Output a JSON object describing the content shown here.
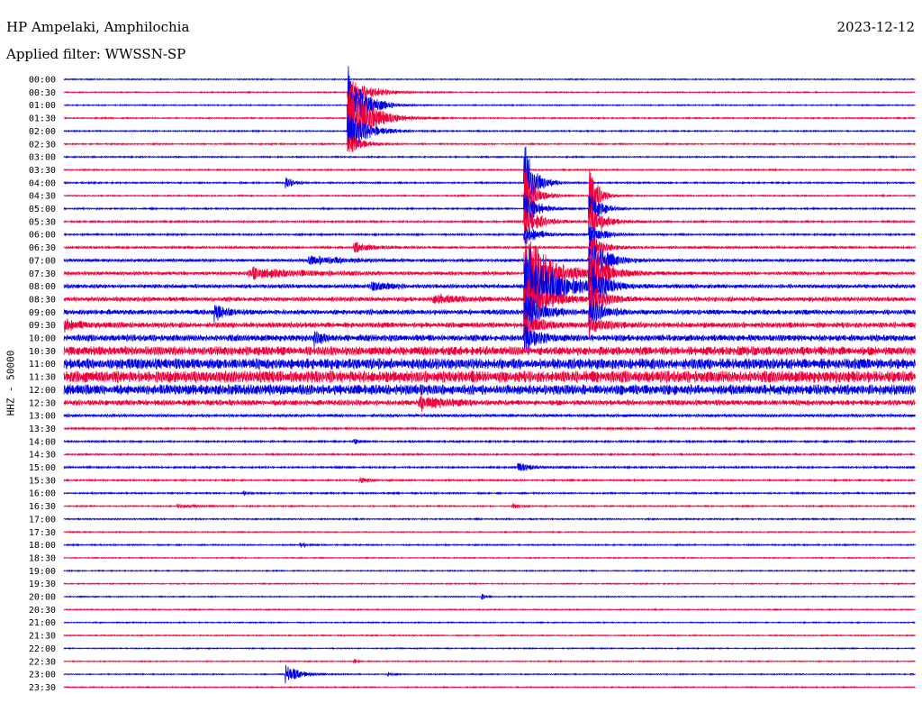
{
  "header": {
    "station": "HP Ampelaki, Amphilochia",
    "date": "2023-12-12",
    "filter": "Applied filter: WWSSN-SP"
  },
  "colors": {
    "trace_a": "#0000e6",
    "trace_b": "#f0003c"
  },
  "chart_data": {
    "type": "line",
    "title": "HP Ampelaki, Amphilochia",
    "ylabel": "HHZ - 50000",
    "x_range_min": [
      0,
      30
    ],
    "rows": [
      "00:00",
      "00:30",
      "01:00",
      "01:30",
      "02:00",
      "02:30",
      "03:00",
      "03:30",
      "04:00",
      "04:30",
      "05:00",
      "05:30",
      "06:00",
      "06:30",
      "07:00",
      "07:30",
      "08:00",
      "08:30",
      "09:00",
      "09:30",
      "10:00",
      "10:30",
      "11:00",
      "11:30",
      "12:00",
      "12:30",
      "13:00",
      "13:30",
      "14:00",
      "14:30",
      "15:00",
      "15:30",
      "16:00",
      "16:30",
      "17:00",
      "17:30",
      "18:00",
      "18:30",
      "19:00",
      "19:30",
      "20:00",
      "20:30",
      "21:00",
      "21:30",
      "22:00",
      "22:30",
      "23:00",
      "23:30"
    ],
    "noise_level": [
      0.5,
      0.5,
      0.5,
      0.6,
      0.6,
      0.6,
      0.6,
      0.6,
      0.7,
      0.6,
      0.7,
      0.8,
      0.8,
      1.0,
      1.2,
      1.4,
      1.6,
      1.8,
      2.0,
      2.2,
      2.6,
      3.6,
      4.4,
      4.8,
      4.2,
      2.2,
      1.2,
      0.9,
      0.8,
      0.7,
      0.8,
      0.7,
      0.7,
      0.6,
      0.6,
      0.5,
      0.6,
      0.5,
      0.5,
      0.5,
      0.5,
      0.5,
      0.5,
      0.5,
      0.5,
      0.5,
      0.5,
      0.5
    ],
    "events": [
      {
        "row": 1,
        "t": 10.0,
        "amp": 14,
        "dur": 1.6
      },
      {
        "row": 2,
        "t": 10.0,
        "amp": 36,
        "dur": 1.2
      },
      {
        "row": 3,
        "t": 10.0,
        "amp": 36,
        "dur": 1.6
      },
      {
        "row": 4,
        "t": 10.0,
        "amp": 20,
        "dur": 1.4
      },
      {
        "row": 5,
        "t": 10.0,
        "amp": 10,
        "dur": 1.0
      },
      {
        "row": 8,
        "t": 7.8,
        "amp": 6,
        "dur": 0.6
      },
      {
        "row": 13,
        "t": 10.2,
        "amp": 5,
        "dur": 1.2
      },
      {
        "row": 14,
        "t": 8.6,
        "amp": 4,
        "dur": 3.0
      },
      {
        "row": 15,
        "t": 6.5,
        "amp": 5,
        "dur": 4.0
      },
      {
        "row": 16,
        "t": 10.8,
        "amp": 5,
        "dur": 1.2
      },
      {
        "row": 17,
        "t": 13.0,
        "amp": 4,
        "dur": 2.0
      },
      {
        "row": 18,
        "t": 5.3,
        "amp": 8,
        "dur": 0.8
      },
      {
        "row": 19,
        "t": 0.0,
        "amp": 5,
        "dur": 1.5
      },
      {
        "row": 20,
        "t": 8.8,
        "amp": 6,
        "dur": 0.8
      },
      {
        "row": 8,
        "t": 16.2,
        "amp": 40,
        "dur": 0.8
      },
      {
        "row": 9,
        "t": 16.2,
        "amp": 30,
        "dur": 0.8
      },
      {
        "row": 10,
        "t": 16.2,
        "amp": 18,
        "dur": 1.0
      },
      {
        "row": 11,
        "t": 16.2,
        "amp": 14,
        "dur": 1.2
      },
      {
        "row": 12,
        "t": 16.2,
        "amp": 10,
        "dur": 1.2
      },
      {
        "row": 15,
        "t": 16.2,
        "amp": 45,
        "dur": 1.8
      },
      {
        "row": 16,
        "t": 16.2,
        "amp": 45,
        "dur": 2.0
      },
      {
        "row": 17,
        "t": 16.2,
        "amp": 28,
        "dur": 1.5
      },
      {
        "row": 18,
        "t": 16.2,
        "amp": 22,
        "dur": 1.2
      },
      {
        "row": 19,
        "t": 16.2,
        "amp": 14,
        "dur": 1.0
      },
      {
        "row": 20,
        "t": 16.2,
        "amp": 12,
        "dur": 1.0
      },
      {
        "row": 9,
        "t": 18.5,
        "amp": 30,
        "dur": 0.6
      },
      {
        "row": 10,
        "t": 18.5,
        "amp": 20,
        "dur": 0.8
      },
      {
        "row": 11,
        "t": 18.5,
        "amp": 18,
        "dur": 1.0
      },
      {
        "row": 12,
        "t": 18.5,
        "amp": 12,
        "dur": 1.0
      },
      {
        "row": 13,
        "t": 18.5,
        "amp": 14,
        "dur": 1.0
      },
      {
        "row": 14,
        "t": 18.5,
        "amp": 24,
        "dur": 1.2
      },
      {
        "row": 15,
        "t": 18.5,
        "amp": 26,
        "dur": 1.2
      },
      {
        "row": 16,
        "t": 18.5,
        "amp": 22,
        "dur": 1.0
      },
      {
        "row": 17,
        "t": 18.5,
        "amp": 18,
        "dur": 1.0
      },
      {
        "row": 18,
        "t": 18.5,
        "amp": 14,
        "dur": 1.0
      },
      {
        "row": 19,
        "t": 18.5,
        "amp": 10,
        "dur": 1.0
      },
      {
        "row": 25,
        "t": 12.5,
        "amp": 7,
        "dur": 1.6
      },
      {
        "row": 28,
        "t": 10.2,
        "amp": 4,
        "dur": 0.3
      },
      {
        "row": 30,
        "t": 16.0,
        "amp": 4,
        "dur": 1.0
      },
      {
        "row": 31,
        "t": 10.4,
        "amp": 3,
        "dur": 0.8
      },
      {
        "row": 32,
        "t": 6.3,
        "amp": 3,
        "dur": 0.3
      },
      {
        "row": 33,
        "t": 4.0,
        "amp": 2,
        "dur": 1.2
      },
      {
        "row": 33,
        "t": 15.8,
        "amp": 2,
        "dur": 0.7
      },
      {
        "row": 36,
        "t": 8.3,
        "amp": 3,
        "dur": 0.4
      },
      {
        "row": 40,
        "t": 14.7,
        "amp": 3,
        "dur": 0.3
      },
      {
        "row": 46,
        "t": 7.8,
        "amp": 9,
        "dur": 1.0
      },
      {
        "row": 46,
        "t": 11.4,
        "amp": 2,
        "dur": 0.4
      },
      {
        "row": 45,
        "t": 10.2,
        "amp": 3,
        "dur": 0.2
      }
    ]
  }
}
